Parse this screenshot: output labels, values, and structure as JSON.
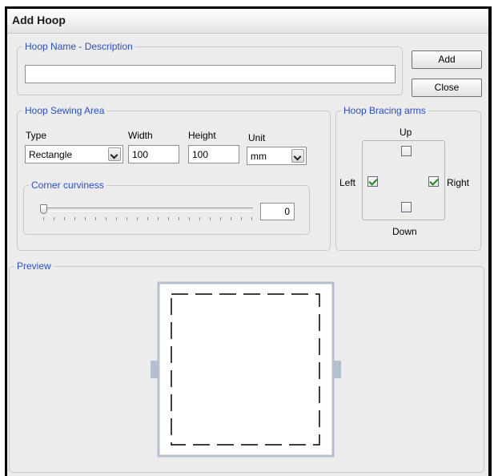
{
  "window": {
    "title": "Add Hoop"
  },
  "name_group": {
    "legend": "Hoop Name - Description",
    "input_value": ""
  },
  "buttons": {
    "add": "Add",
    "close": "Close"
  },
  "sewing_area": {
    "legend": "Hoop Sewing Area",
    "type_label": "Type",
    "type_value": "Rectangle",
    "width_label": "Width",
    "width_value": "100",
    "height_label": "Height",
    "height_value": "100",
    "unit_label": "Unit",
    "unit_value": "mm"
  },
  "curviness": {
    "legend": "Corner curviness",
    "value": "0",
    "level": 0
  },
  "bracing": {
    "legend": "Hoop Bracing arms",
    "up_label": "Up",
    "down_label": "Down",
    "left_label": "Left",
    "right_label": "Right",
    "up_checked": false,
    "down_checked": false,
    "left_checked": true,
    "right_checked": true
  },
  "preview": {
    "legend": "Preview"
  },
  "colors": {
    "legend_text": "#2a4fc0",
    "hoop_frame": "#b4bfd2",
    "check_mark": "#1d8a1d"
  }
}
